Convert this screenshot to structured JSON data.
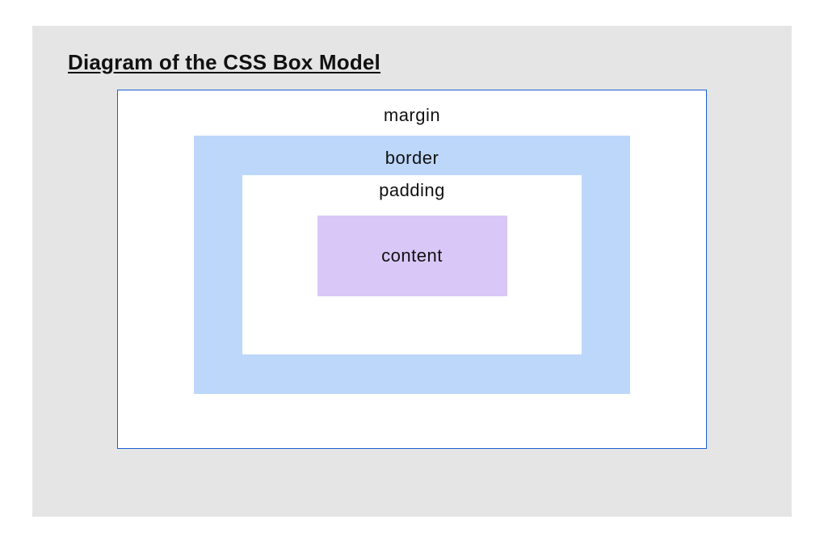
{
  "title": "Diagram of the CSS Box Model",
  "layers": {
    "margin": {
      "label": "margin",
      "fill": "#ffffff",
      "border": "#1a5fd6"
    },
    "border": {
      "label": "border",
      "fill": "#bdd7fb"
    },
    "padding": {
      "label": "padding",
      "fill": "#ffffff"
    },
    "content": {
      "label": "content",
      "fill": "#d9c8f7"
    }
  }
}
